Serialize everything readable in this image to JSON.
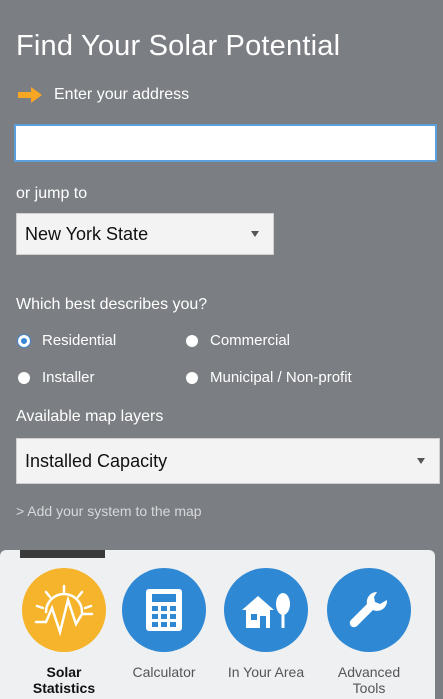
{
  "title": "Find Your Solar Potential",
  "address": {
    "label": "Enter your address",
    "value": "",
    "placeholder": ""
  },
  "jump": {
    "label": "or jump to",
    "selected": "New York State"
  },
  "describe": {
    "label": "Which best describes you?",
    "options": [
      "Residential",
      "Commercial",
      "Installer",
      "Municipal / Non-profit"
    ],
    "selected": "Residential"
  },
  "layers": {
    "label": "Available map layers",
    "selected": "Installed Capacity"
  },
  "add_link": "> Add your system to the map",
  "tools": [
    {
      "label": "Solar\nStatistics",
      "icon": "solar-statistics-icon",
      "color": "#f5b42c",
      "active": true
    },
    {
      "label": "Calculator",
      "icon": "calculator-icon",
      "color": "#2f88d3",
      "active": false
    },
    {
      "label": "In Your Area",
      "icon": "house-tree-icon",
      "color": "#2f88d3",
      "active": false
    },
    {
      "label": "Advanced Tools",
      "icon": "wrench-icon",
      "color": "#2f88d3",
      "active": false
    }
  ],
  "colors": {
    "background": "#7b7e82",
    "accent_orange": "#f5b42c",
    "accent_blue": "#2f88d3"
  }
}
